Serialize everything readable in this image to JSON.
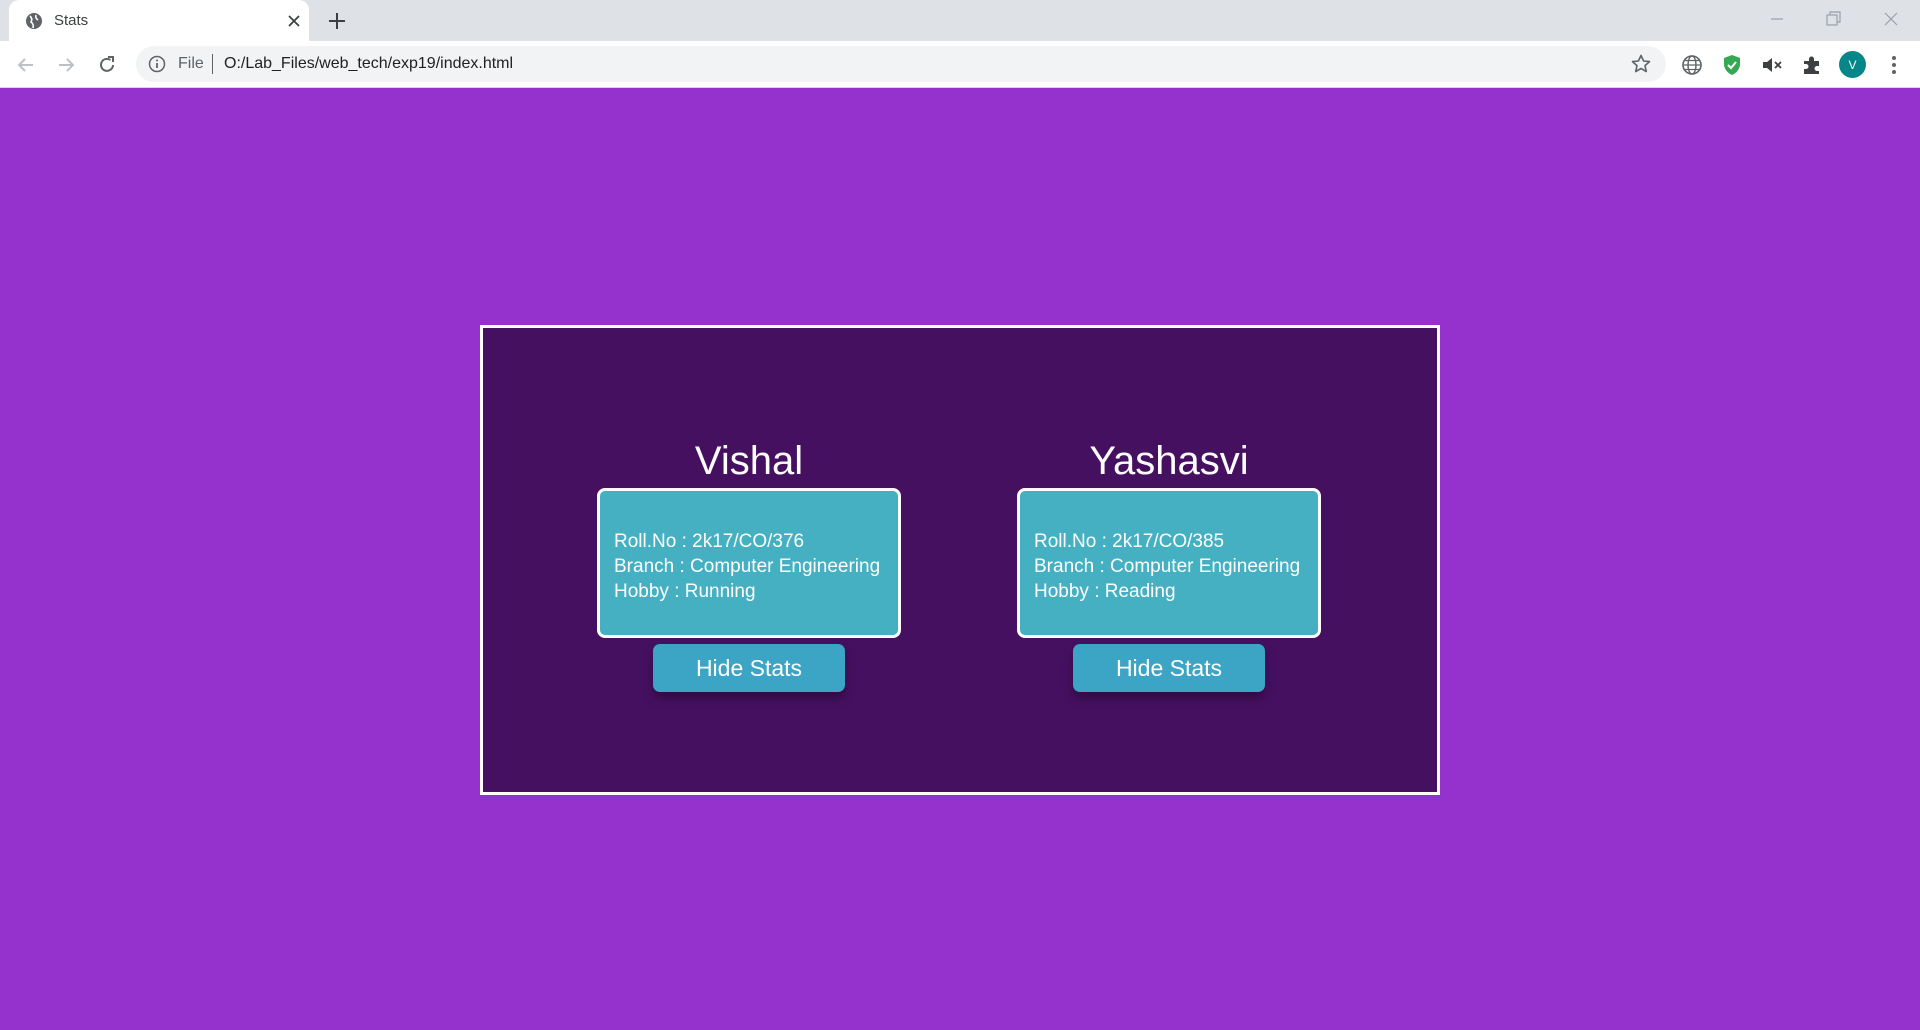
{
  "browser": {
    "tab_title": "Stats",
    "scheme_label": "File",
    "url": "O:/Lab_Files/web_tech/exp19/index.html",
    "profile_initial": "V"
  },
  "page": {
    "background_color": "#9531cc",
    "stage_color": "#461061",
    "card_color": "#45b0c2",
    "people": [
      {
        "name": "Vishal",
        "roll": "Roll.No : 2k17/CO/376",
        "branch": "Branch : Computer Engineering",
        "hobby": "Hobby : Running",
        "button_label": "Hide Stats"
      },
      {
        "name": "Yashasvi",
        "roll": "Roll.No : 2k17/CO/385",
        "branch": "Branch : Computer Engineering",
        "hobby": "Hobby : Reading",
        "button_label": "Hide Stats"
      }
    ]
  }
}
